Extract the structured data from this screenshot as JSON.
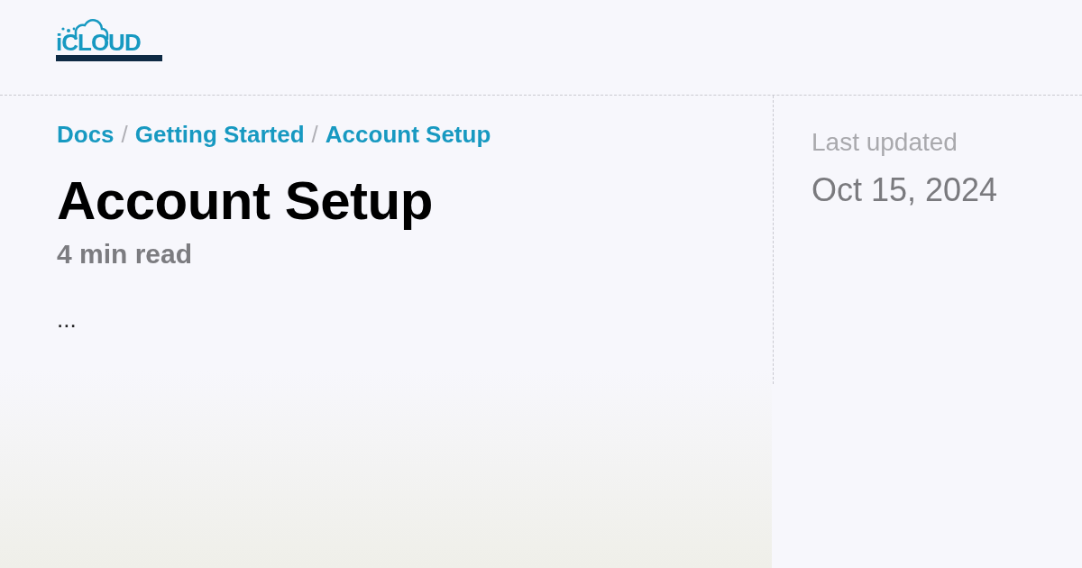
{
  "logo": {
    "top": "iCLOUD"
  },
  "breadcrumbs": [
    {
      "label": "Docs"
    },
    {
      "label": "Getting Started"
    },
    {
      "label": "Account Setup"
    }
  ],
  "breadcrumb_separator": "/",
  "title": "Account Setup",
  "reading_time": "4 min read",
  "excerpt": "...",
  "sidebar": {
    "label": "Last updated",
    "date": "Oct 15, 2024"
  }
}
